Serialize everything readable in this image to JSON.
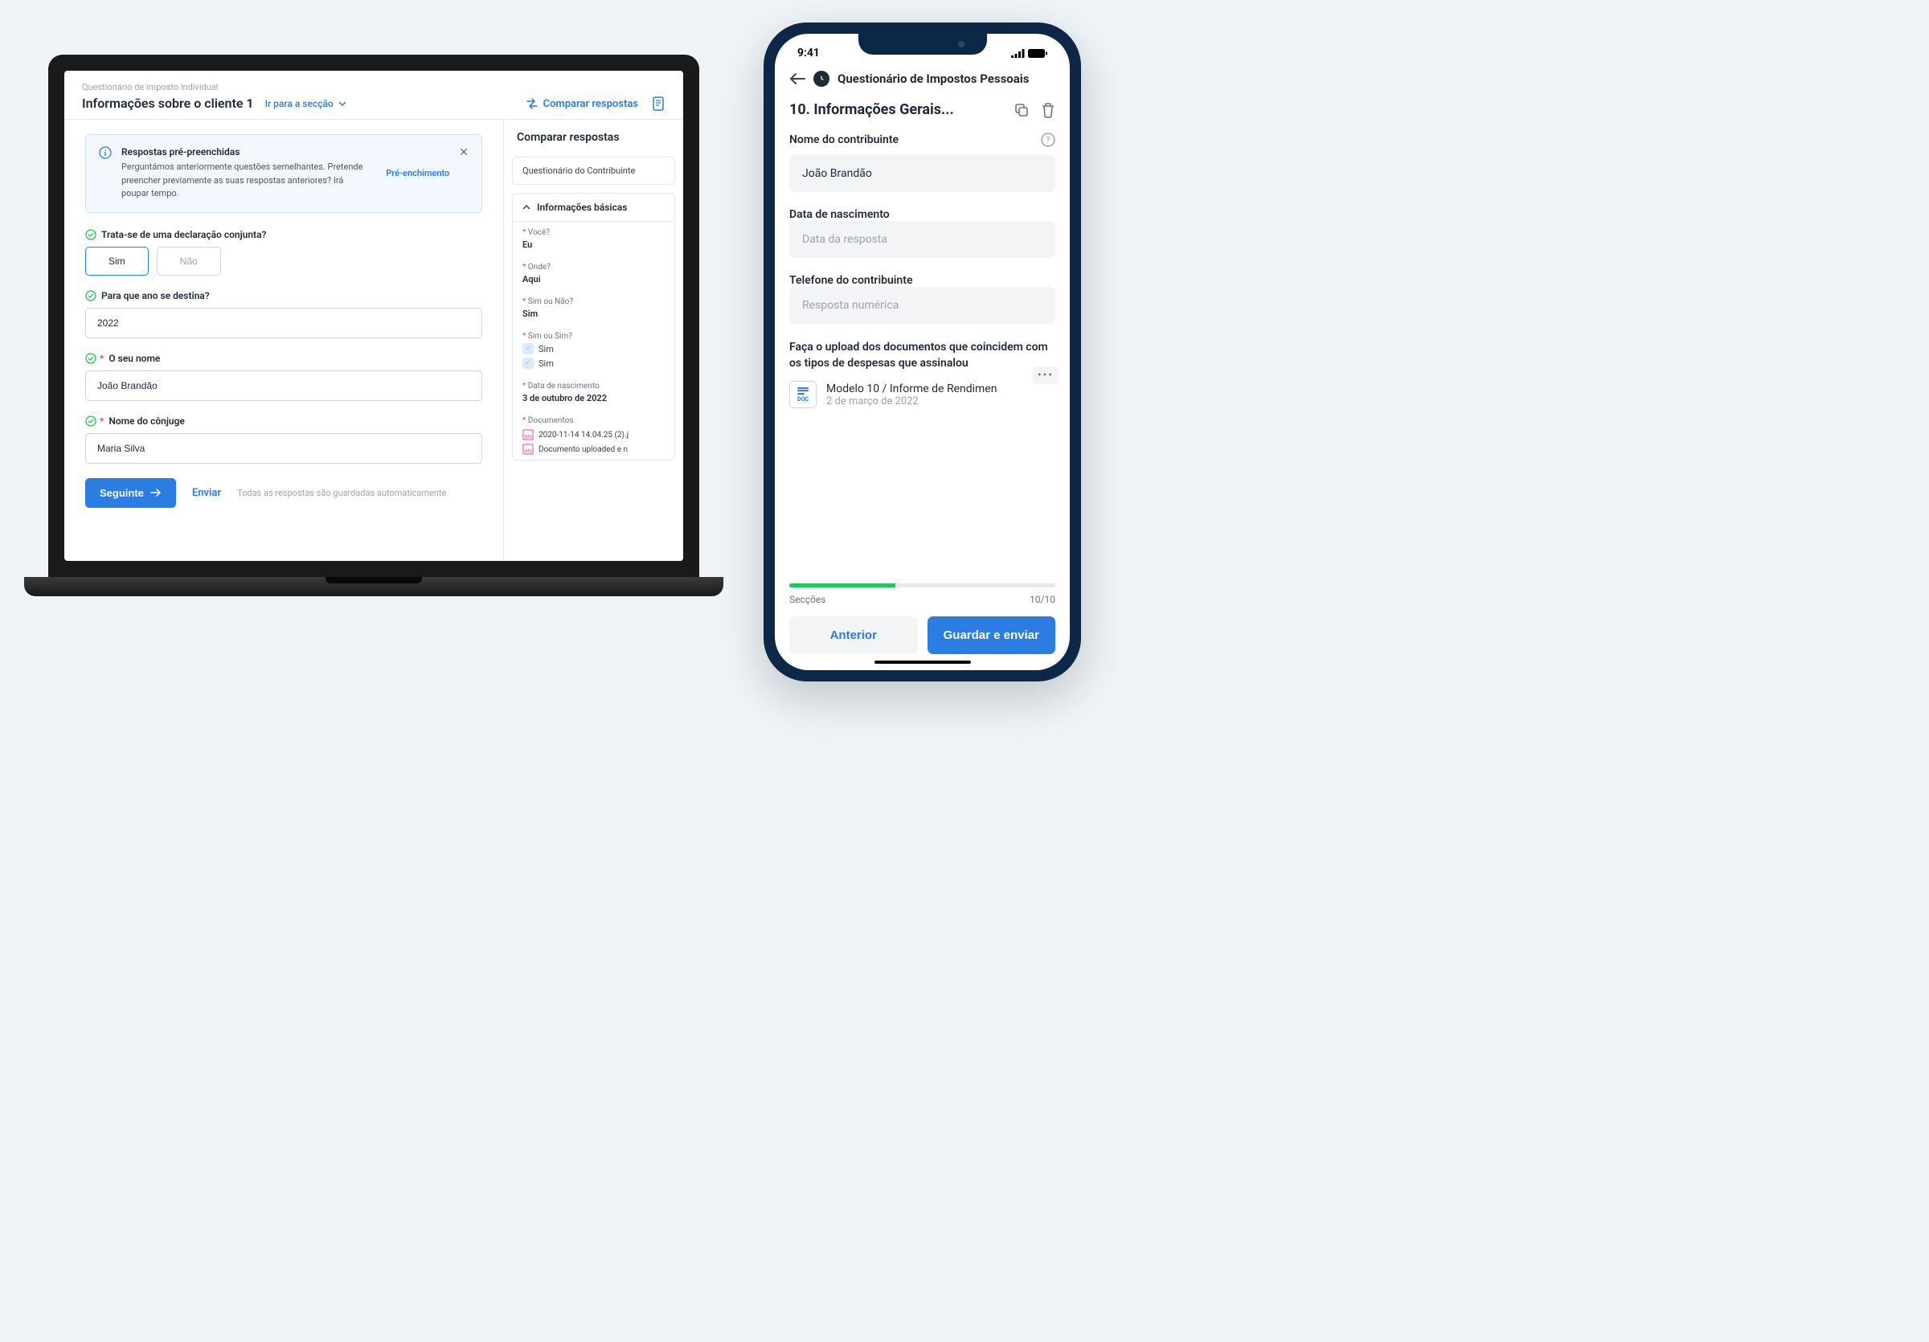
{
  "laptop": {
    "breadcrumb": "Questionário de imposto individual",
    "title": "Informações sobre o cliente 1",
    "section_link": "Ir para a secção",
    "compare_label": "Comparar respostas",
    "info_box": {
      "title": "Respostas pré-preenchidas",
      "text": "Perguntámos anteriormente questões semelhantes. Pretende preencher previamente as suas respostas anteriores? Irá poupar tempo.",
      "action": "Pré-enchimento"
    },
    "questions": {
      "joint": {
        "label": "Trata-se de uma declaração conjunta?",
        "yes": "Sim",
        "no": "Não"
      },
      "year": {
        "label": "Para que ano se destina?",
        "value": "2022"
      },
      "name": {
        "label": "O seu nome",
        "value": "João Brandão"
      },
      "spouse": {
        "label": "Nome do cônjuge",
        "value": "Maria Silva"
      }
    },
    "footer": {
      "next": "Seguinte",
      "send": "Enviar",
      "autosave": "Todas as respostas são guardadas automaticamente"
    },
    "right_panel": {
      "title": "Comparar respostas",
      "card": "Questionário do Contribuinte",
      "section": "Informações básicas",
      "items": {
        "you": {
          "label": "Você?",
          "value": "Eu"
        },
        "where": {
          "label": "Onde?",
          "value": "Aqui"
        },
        "yesno": {
          "label": "Sim ou Não?",
          "value": "Sim"
        },
        "yesyes": {
          "label": "Sim ou Sim?",
          "opt1": "Sim",
          "opt2": "Sim"
        },
        "dob": {
          "label": "Data de nascimento",
          "value": "3 de outubro de 2022"
        },
        "docs": {
          "label": "Documentos",
          "doc1": "2020-11-14 14.04.25 (2).j",
          "doc2": "Documento uploaded e n"
        }
      }
    }
  },
  "phone": {
    "time": "9:41",
    "header_title": "Questionário de Impostos Pessoais",
    "section_title": "10. Informações Gerais...",
    "fields": {
      "name": {
        "label": "Nome do contribuinte",
        "value": "João Brandão"
      },
      "dob": {
        "label": "Data de nascimento",
        "placeholder": "Data da resposta"
      },
      "phone": {
        "label": "Telefone do contribuinte",
        "placeholder": "Resposta numérica"
      },
      "upload": {
        "label": "Faça o upload dos documentos que coincidem com os tipos de despesas que assinalou",
        "doc_name": "Modelo 10 / Informe de Rendimen",
        "doc_date": "2 de março de 2022"
      }
    },
    "sections": {
      "label": "Secções",
      "count": "10/10"
    },
    "footer": {
      "prev": "Anterior",
      "submit": "Guardar e enviar"
    }
  }
}
